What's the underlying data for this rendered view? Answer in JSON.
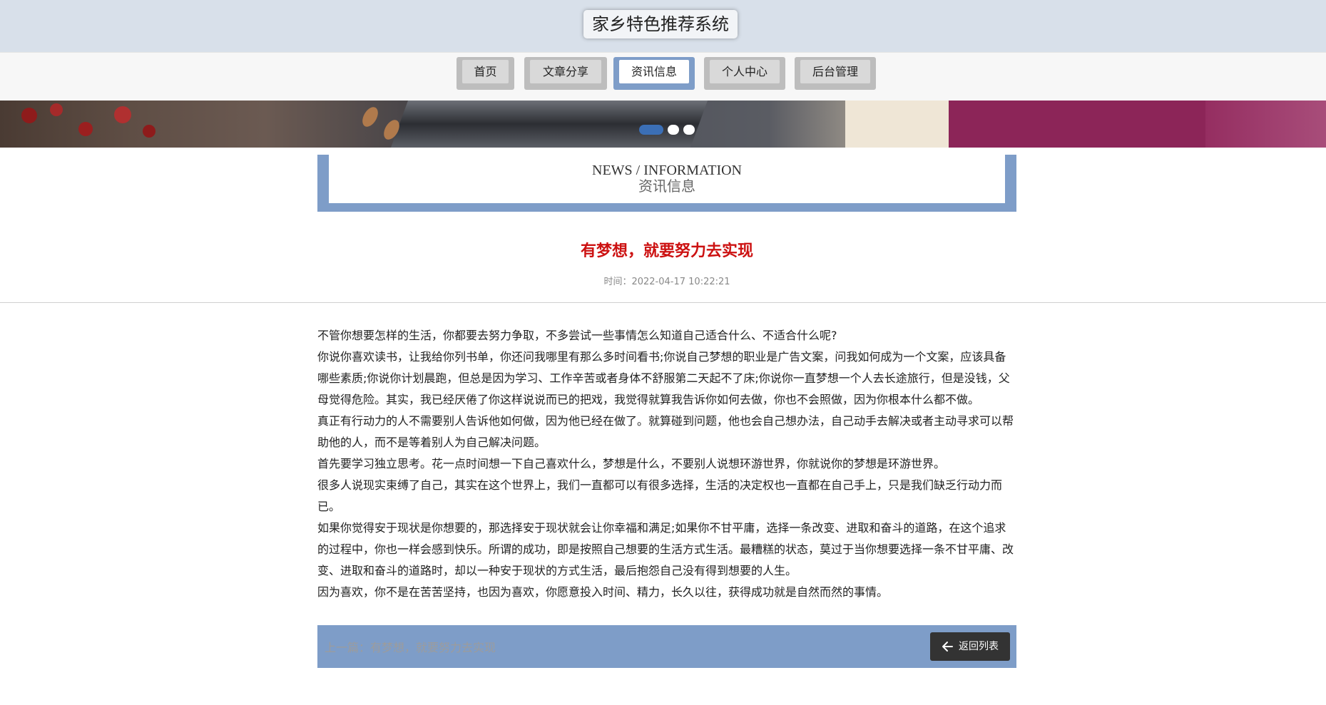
{
  "header": {
    "site_title": "家乡特色推荐系统"
  },
  "nav": {
    "items": [
      {
        "label": "首页"
      },
      {
        "label": "文章分享"
      },
      {
        "label": "资讯信息"
      },
      {
        "label": "个人中心"
      },
      {
        "label": "后台管理"
      }
    ],
    "active_index": 2
  },
  "banner": {
    "slide_count": 3,
    "active_slide": 0
  },
  "section": {
    "title_en": "NEWS / INFORMATION",
    "title_cn": "资讯信息"
  },
  "article": {
    "title": "有梦想，就要努力去实现",
    "time_label": "时间：",
    "time_value": "2022-04-17 10:22:21",
    "paragraphs": [
      "不管你想要怎样的生活，你都要去努力争取，不多尝试一些事情怎么知道自己适合什么、不适合什么呢?",
      "你说你喜欢读书，让我给你列书单，你还问我哪里有那么多时间看书;你说自己梦想的职业是广告文案，问我如何成为一个文案，应该具备哪些素质;你说你计划晨跑，但总是因为学习、工作辛苦或者身体不舒服第二天起不了床;你说你一直梦想一个人去长途旅行，但是没钱，父母觉得危险。其实，我已经厌倦了你这样说说而已的把戏，我觉得就算我告诉你如何去做，你也不会照做，因为你根本什么都不做。",
      "真正有行动力的人不需要别人告诉他如何做，因为他已经在做了。就算碰到问题，他也会自己想办法，自己动手去解决或者主动寻求可以帮助他的人，而不是等着别人为自己解决问题。",
      "首先要学习独立思考。花一点时间想一下自己喜欢什么，梦想是什么，不要别人说想环游世界，你就说你的梦想是环游世界。",
      "很多人说现实束缚了自己，其实在这个世界上，我们一直都可以有很多选择，生活的决定权也一直都在自己手上，只是我们缺乏行动力而已。",
      "如果你觉得安于现状是你想要的，那选择安于现状就会让你幸福和满足;如果你不甘平庸，选择一条改变、进取和奋斗的道路，在这个追求的过程中，你也一样会感到快乐。所谓的成功，即是按照自己想要的生活方式生活。最糟糕的状态，莫过于当你想要选择一条不甘平庸、改变、进取和奋斗的道路时，却以一种安于现状的方式生活，最后抱怨自己没有得到想要的人生。",
      "因为喜欢，你不是在苦苦坚持，也因为喜欢，你愿意投入时间、精力，长久以往，获得成功就是自然而然的事情。"
    ]
  },
  "footer": {
    "prev_article": "上一篇：有梦想，就要努力去实现",
    "back_label": "返回列表"
  }
}
